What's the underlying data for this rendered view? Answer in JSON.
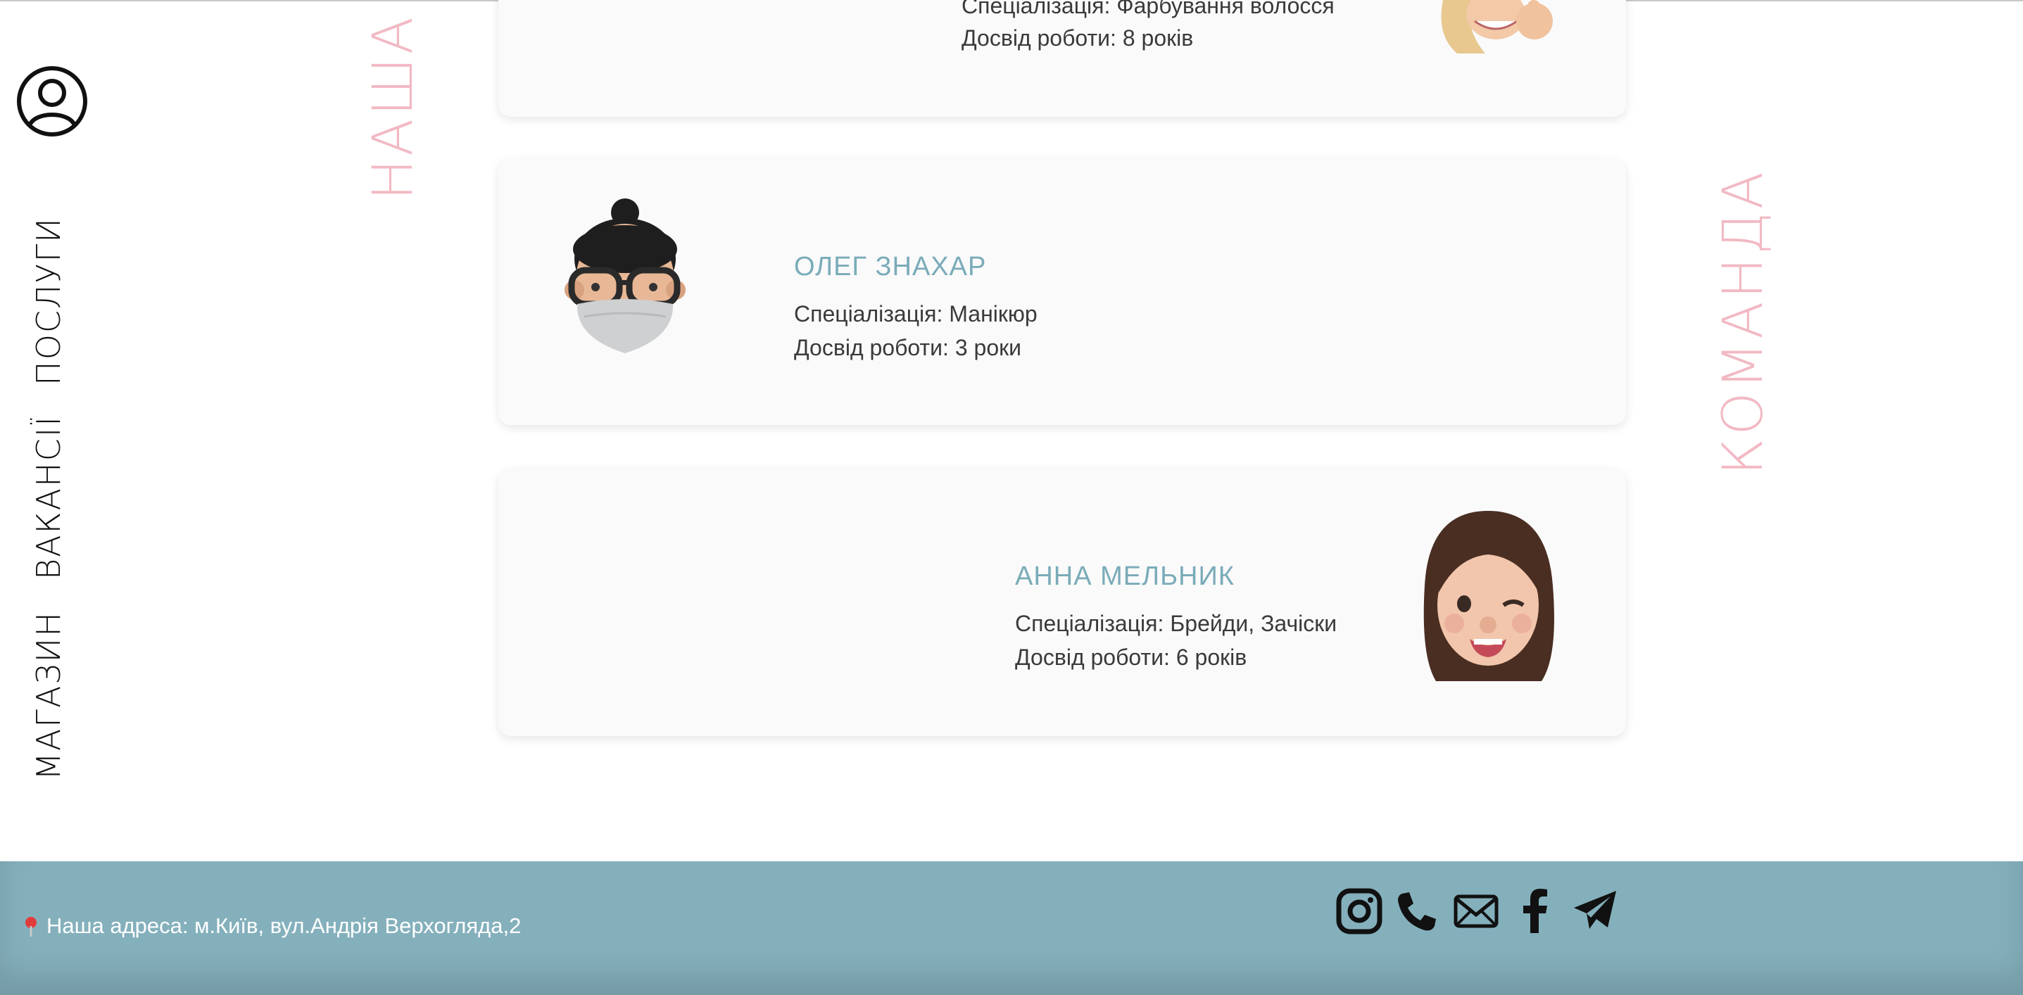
{
  "nav": {
    "services": "ПОСЛУГИ",
    "vacancies": "ВАКАНСІЇ",
    "shop": "МАГАЗИН"
  },
  "side_headings": {
    "left": "НАША",
    "right": "КОМАНДА"
  },
  "team": [
    {
      "specialization": "Спеціалізація: Фарбування волосся",
      "experience": "Досвід роботи: 8 років"
    },
    {
      "name": "ОЛЕГ ЗНАХАР",
      "specialization": "Спеціалізація: Манікюр",
      "experience": "Досвід роботи: 3 роки"
    },
    {
      "name": "АННА МЕЛЬНИК",
      "specialization": "Спеціалізація: Брейди, Зачіски",
      "experience": "Досвід роботи: 6 років"
    }
  ],
  "footer": {
    "address": "Наша адреса: м.Київ, вул.Андрія Верхогляда,2",
    "icons": [
      "instagram-icon",
      "phone-icon",
      "mail-icon",
      "facebook-icon",
      "telegram-icon"
    ]
  },
  "colors": {
    "accent_pink": "#f2b9c3",
    "name_blue": "#7aabb9",
    "footer_bg": "#84b0bc"
  }
}
